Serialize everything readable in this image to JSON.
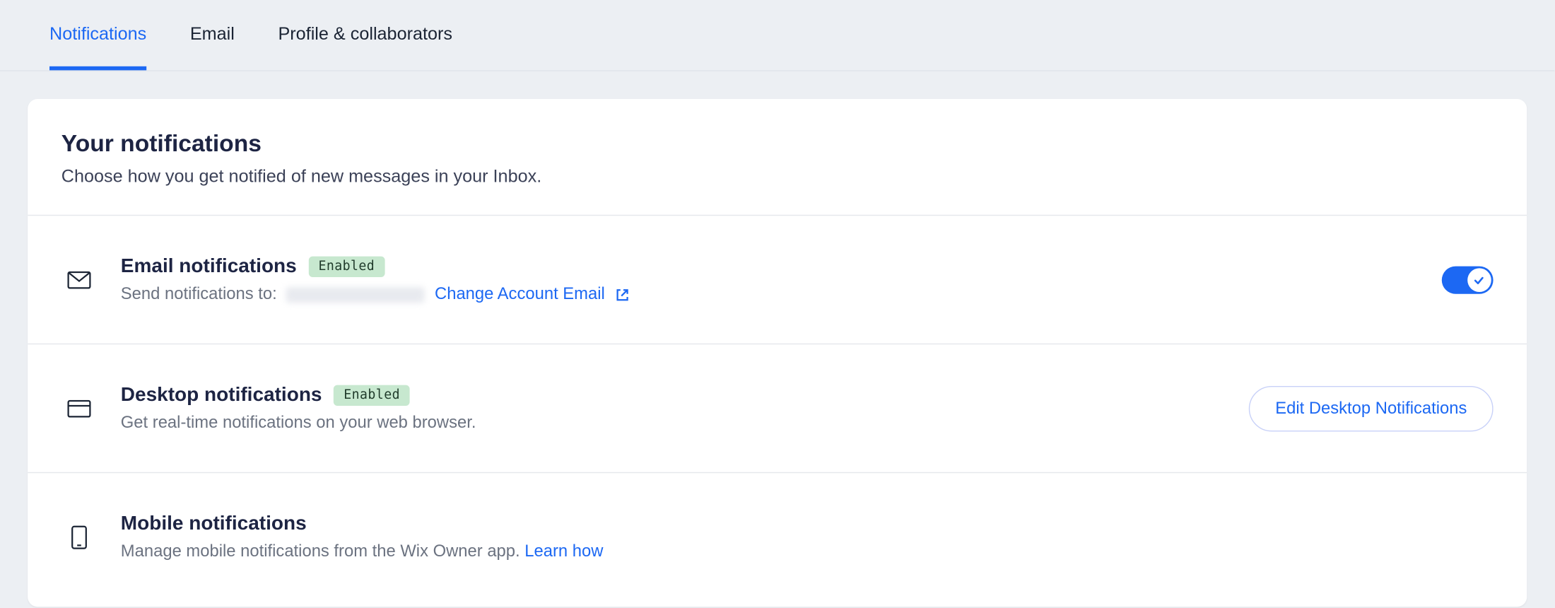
{
  "tabs": [
    {
      "label": "Notifications",
      "active": true
    },
    {
      "label": "Email",
      "active": false
    },
    {
      "label": "Profile & collaborators",
      "active": false
    }
  ],
  "header": {
    "title": "Your notifications",
    "subtitle": "Choose how you get notified of new messages in your Inbox."
  },
  "rows": {
    "email": {
      "title": "Email notifications",
      "badge": "Enabled",
      "desc_prefix": "Send notifications to:",
      "change_link": "Change Account Email"
    },
    "desktop": {
      "title": "Desktop notifications",
      "badge": "Enabled",
      "desc": "Get real-time notifications on your web browser.",
      "button": "Edit Desktop Notifications"
    },
    "mobile": {
      "title": "Mobile notifications",
      "desc": "Manage mobile notifications from the Wix Owner app. ",
      "learn_link": "Learn how"
    }
  }
}
